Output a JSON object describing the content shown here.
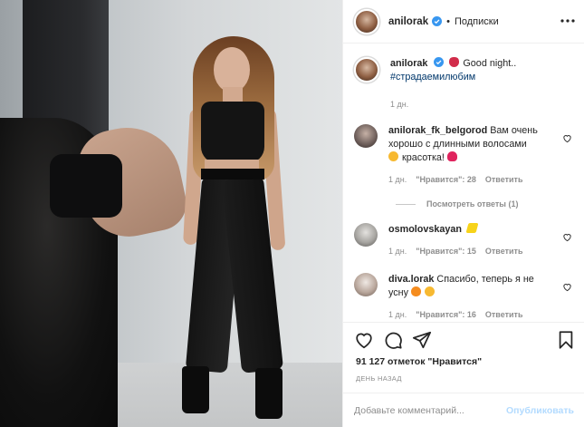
{
  "header": {
    "username": "anilorak",
    "separator": "•",
    "follow_label": "Подписки",
    "verified_icon": "verified-badge-icon",
    "more_icon": "more-options-icon"
  },
  "caption": {
    "username": "anilorak",
    "text": "Good night..",
    "hashtag": "#страдаемилюбим",
    "time": "1 дн."
  },
  "comments": [
    {
      "username": "anilorak_fk_belgorod",
      "text": "Вам очень хорошо с длинными волосами",
      "text2": "красотка!",
      "time": "1 дн.",
      "likes": "\"Нравится\": 28",
      "reply": "Ответить",
      "view_replies": "Посмотреть ответы (1)"
    },
    {
      "username": "osmolovskayan",
      "text": "",
      "time": "1 дн.",
      "likes": "\"Нравится\": 15",
      "reply": "Ответить"
    },
    {
      "username": "diva.lorak",
      "text": "Спасибо, теперь я не",
      "text2": "усну",
      "time": "1 дн.",
      "likes": "\"Нравится\": 16",
      "reply": "Ответить"
    }
  ],
  "actions": {
    "likes_text": "91 127 отметок \"Нравится\"",
    "date": "ДЕНЬ НАЗАД"
  },
  "add_comment": {
    "placeholder": "Добавьте комментарий...",
    "publish_label": "Опубликовать"
  },
  "colors": {
    "link": "#00376b",
    "muted": "#8e8e8e",
    "publish_disabled": "#b3dbff",
    "verified": "#3897f0"
  }
}
